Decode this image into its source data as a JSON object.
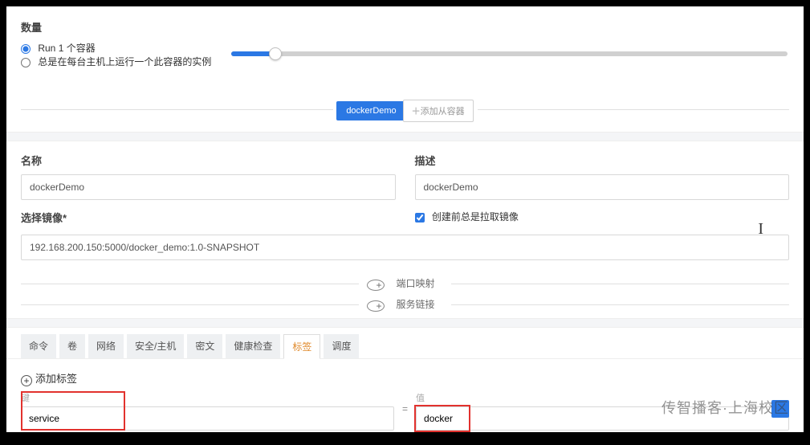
{
  "count": {
    "title": "数量",
    "radio1_label": "Run 1 个容器",
    "radio2_label": "总是在每台主机上运行一个此容器的实例",
    "slider_value": 1
  },
  "pill": {
    "name": "dockerDemo",
    "add_slave": "添加从容器"
  },
  "form": {
    "name_label": "名称",
    "name_value": "dockerDemo",
    "desc_label": "描述",
    "desc_value": "dockerDemo",
    "image_label": "选择镜像*",
    "image_value": "192.168.200.150:5000/docker_demo:1.0-SNAPSHOT",
    "pull_checkbox": "创建前总是拉取镜像",
    "port_map": "端口映射",
    "service_link": "服务链接"
  },
  "tabs": {
    "items": [
      {
        "label": "命令"
      },
      {
        "label": "卷"
      },
      {
        "label": "网络"
      },
      {
        "label": "安全/主机"
      },
      {
        "label": "密文"
      },
      {
        "label": "健康检查"
      },
      {
        "label": "标签"
      },
      {
        "label": "调度"
      }
    ],
    "active_index": 6
  },
  "labels_section": {
    "add_label": "添加标签",
    "key_header": "键",
    "value_header": "值",
    "key": "service",
    "value": "docker"
  },
  "watermark": "传智播客·上海校区"
}
